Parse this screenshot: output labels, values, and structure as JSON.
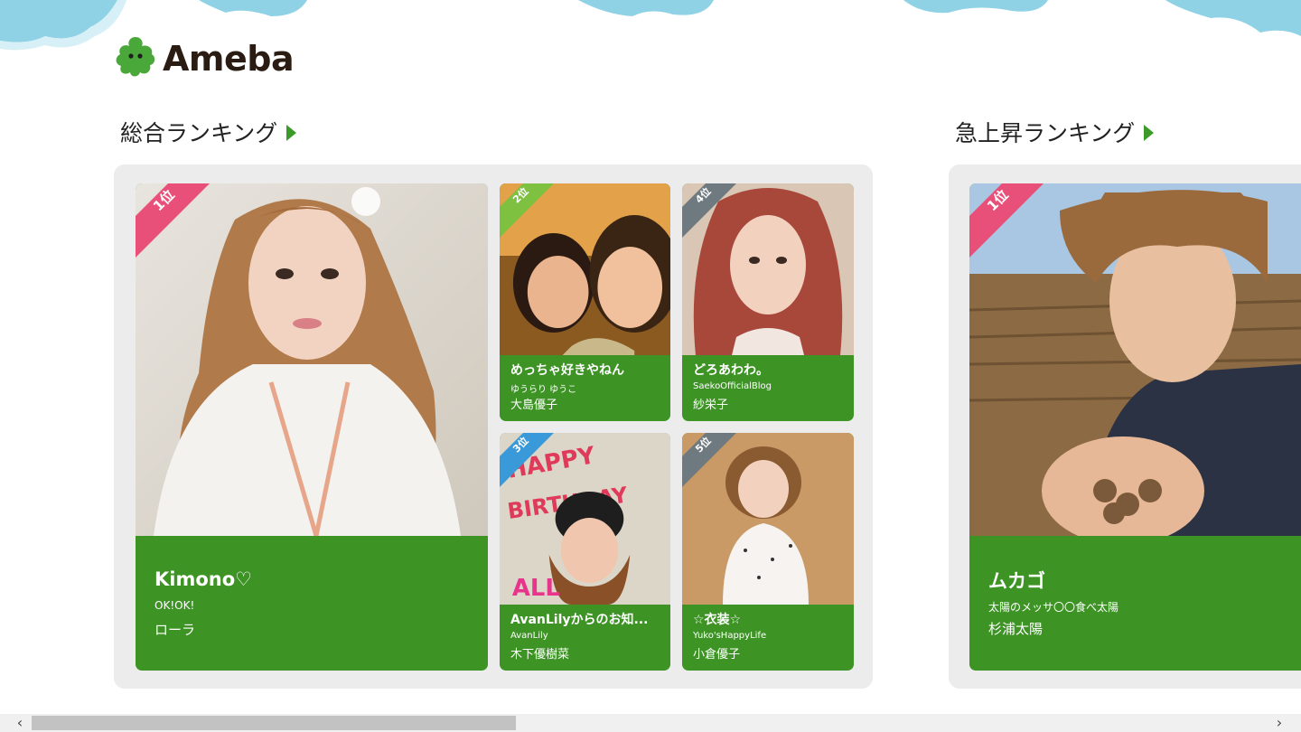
{
  "app": {
    "logo_text": "Ameba"
  },
  "sections": [
    {
      "title": "総合ランキング"
    },
    {
      "title": "急上昇ランキング"
    }
  ],
  "overall": {
    "featured": {
      "rank": "1位",
      "title": "Kimono♡",
      "blog": "OK!OK!",
      "name": "ローラ"
    },
    "cards": [
      {
        "rank": "2位",
        "title": "めっちゃ好きやねん",
        "blog": "ゆうらり ゆうこ",
        "name": "大島優子"
      },
      {
        "rank": "4位",
        "title": "どろあわわ。",
        "blog": "SaekoOfficialBlog",
        "name": "紗栄子"
      },
      {
        "rank": "3位",
        "title": "AvanLilyからのお知...",
        "blog": "AvanLily",
        "name": "木下優樹菜"
      },
      {
        "rank": "5位",
        "title": "☆衣装☆",
        "blog": "Yuko'sHappyLife",
        "name": "小倉優子"
      }
    ]
  },
  "rising": {
    "featured": {
      "rank": "1位",
      "title": "ムカゴ",
      "blog": "太陽のメッサ〇〇食べ太陽",
      "name": "杉浦太陽"
    }
  },
  "colors": {
    "card_green": "#3d9425",
    "badge_pink": "#e8507a",
    "badge_green": "#7ec141",
    "badge_blue": "#3a9ad9",
    "badge_gray": "#6f7a80",
    "arrow_green": "#3c9a2a"
  },
  "icons": {
    "logo": "ameba-mascot-icon",
    "scroll_left": "chevron-left-icon",
    "scroll_right": "chevron-right-icon"
  }
}
